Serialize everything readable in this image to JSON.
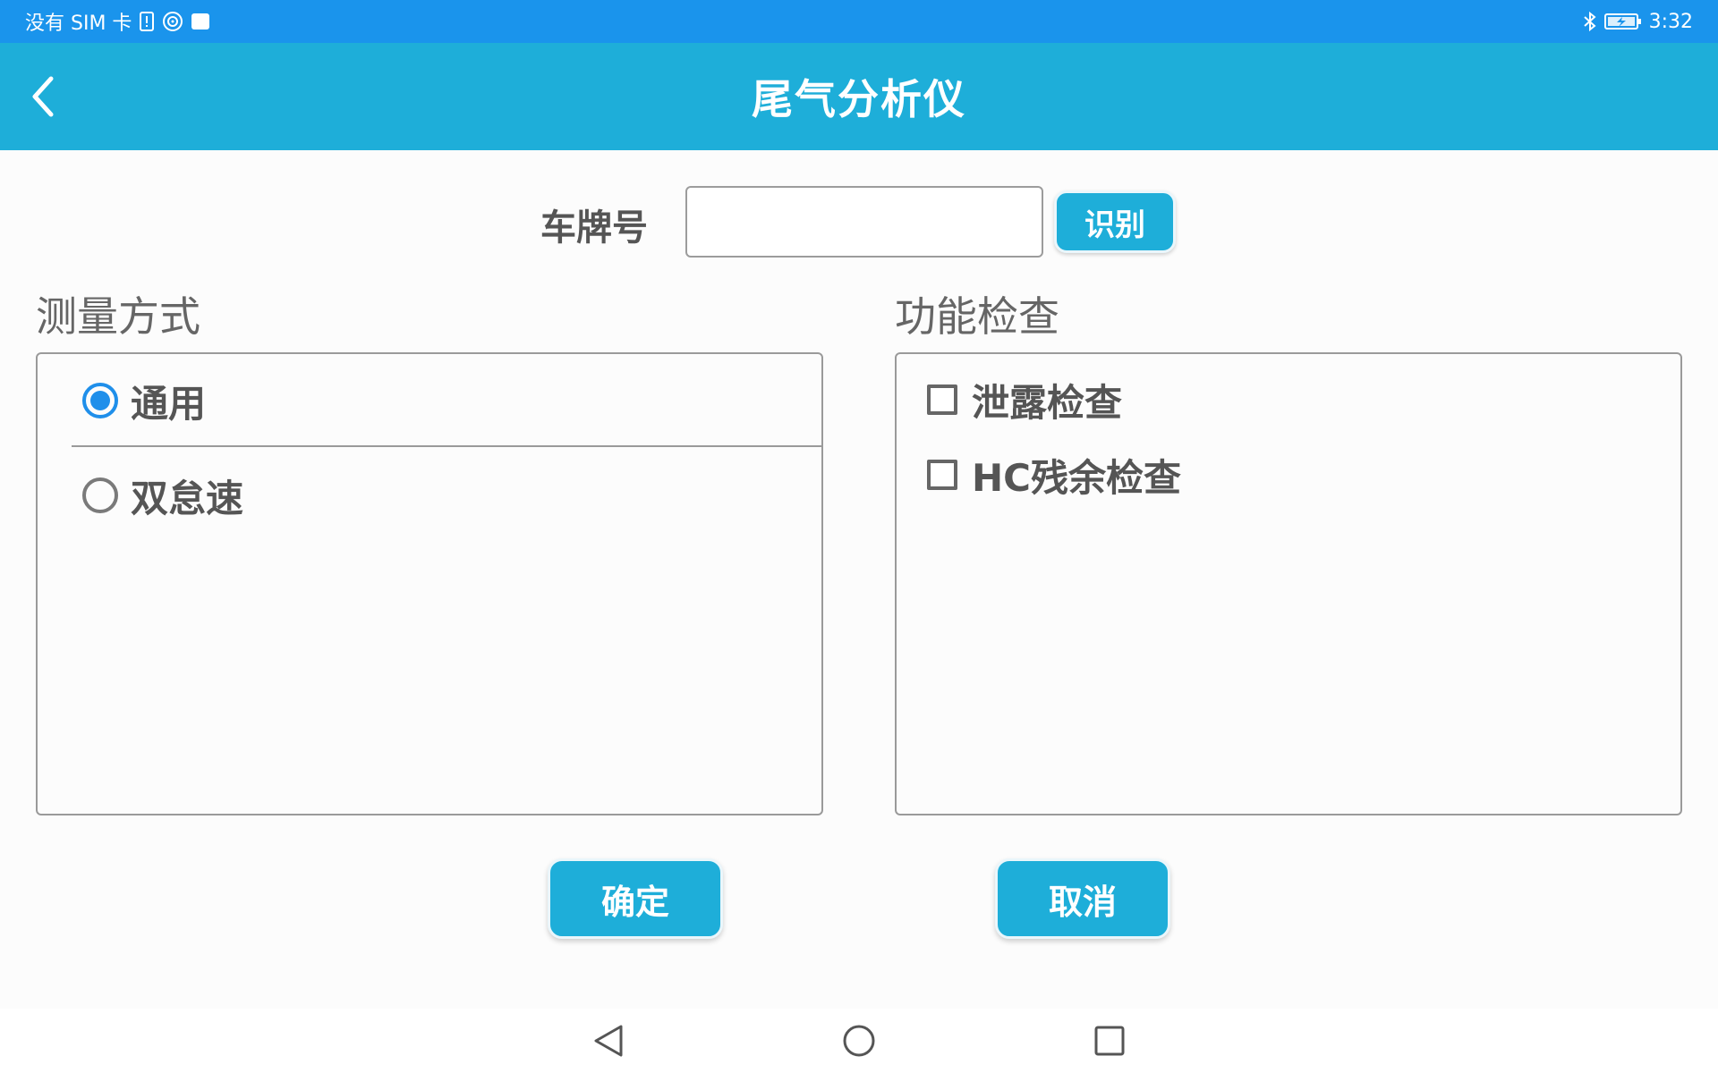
{
  "status_bar": {
    "sim_text": "没有 SIM 卡",
    "time": "3:32"
  },
  "app_bar": {
    "title": "尾气分析仪"
  },
  "plate": {
    "label": "车牌号",
    "value": "",
    "recognize_label": "识别"
  },
  "measure": {
    "title": "测量方式",
    "options": [
      {
        "label": "通用",
        "selected": true
      },
      {
        "label": "双怠速",
        "selected": false
      }
    ]
  },
  "function_check": {
    "title": "功能检查",
    "items": [
      {
        "label": "泄露检查",
        "checked": false
      },
      {
        "label": "HC残余检查",
        "checked": false
      }
    ]
  },
  "actions": {
    "confirm_label": "确定",
    "cancel_label": "取消"
  },
  "colors": {
    "status_bar": "#1a94ec",
    "app_bar": "#1eaed9",
    "radio_selected": "#1f8fea"
  }
}
